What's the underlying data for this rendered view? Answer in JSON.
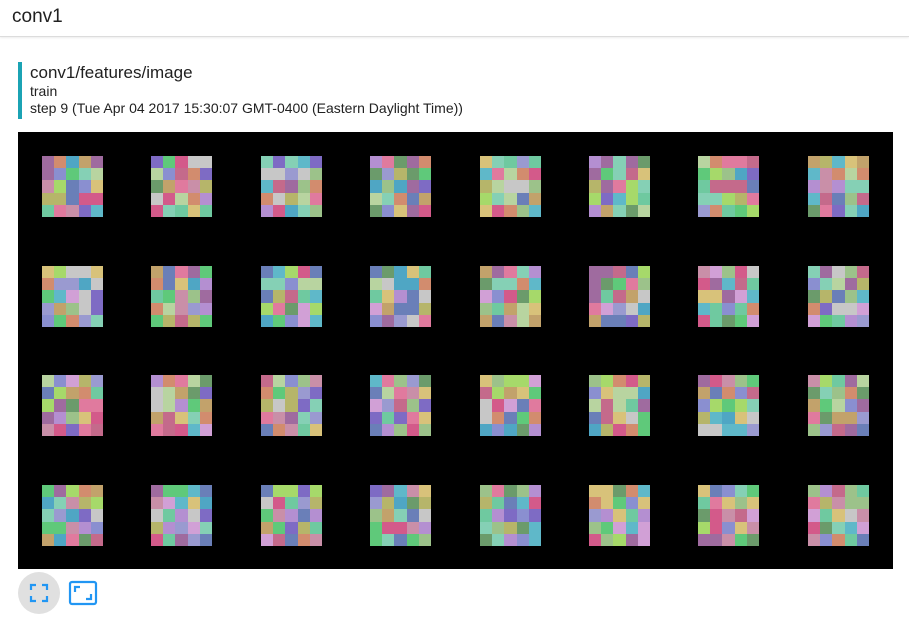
{
  "header": {
    "title": "conv1"
  },
  "card": {
    "tag": "conv1/features/image",
    "run": "train",
    "step": "step 9 (Tue Apr 04 2017 15:30:07 GMT-0400 (Eastern Daylight Time))",
    "accent_color": "#1ba3b4"
  },
  "image_grid": {
    "description_free": true,
    "rows": 4,
    "columns": 8,
    "cells_per_side": 5,
    "palette": [
      "#9cc28a",
      "#d1a0d6",
      "#6fc9a0",
      "#c46a8b",
      "#8a8fd0",
      "#b6b56a",
      "#5fb8c9",
      "#d28c6e",
      "#a6d96a",
      "#7e6bc4",
      "#c7c7c7",
      "#e07a9e",
      "#6b9b6b",
      "#b48fd1",
      "#d8c27a",
      "#4fa6c4",
      "#9f6b9f",
      "#85d0b5",
      "#c98fa8",
      "#6a7fb8",
      "#b8d4a0",
      "#d35a8a",
      "#5fc97a",
      "#9a9ad0",
      "#c2a26b"
    ],
    "background": "#000000"
  },
  "toolbar": {
    "buttons": [
      {
        "icon": "fullscreen-icon",
        "active": true
      },
      {
        "icon": "fit-to-screen-icon",
        "active": false
      }
    ],
    "icon_color": "#2196f3"
  }
}
